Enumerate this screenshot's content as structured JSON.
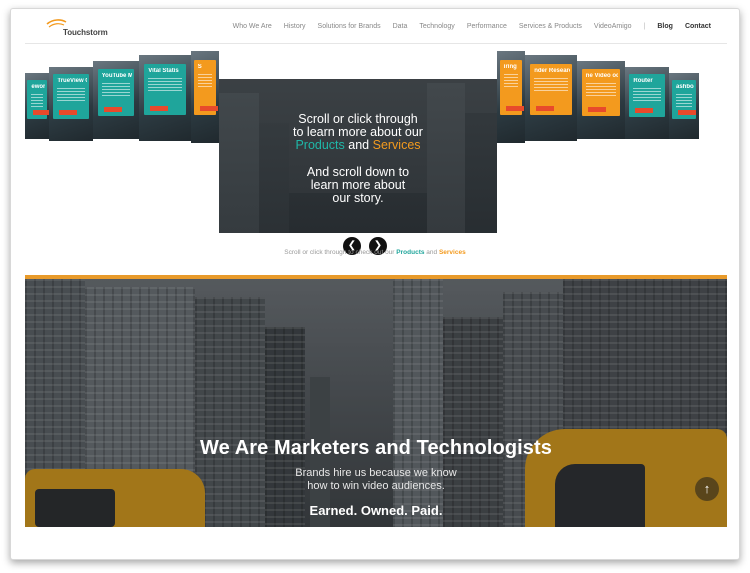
{
  "header": {
    "logo_text": "Touchstorm",
    "nav": [
      {
        "label": "Who We Are",
        "bold": false
      },
      {
        "label": "History",
        "bold": false
      },
      {
        "label": "Solutions for Brands",
        "bold": false
      },
      {
        "label": "Data",
        "bold": false
      },
      {
        "label": "Technology",
        "bold": false
      },
      {
        "label": "Performance",
        "bold": false
      },
      {
        "label": "Services & Products",
        "bold": false
      },
      {
        "label": "VideoAmigo",
        "bold": false
      }
    ],
    "separator": "|",
    "nav_right": [
      {
        "label": "Blog",
        "bold": true
      },
      {
        "label": "Contact",
        "bold": true
      }
    ]
  },
  "carousel": {
    "left_cards": [
      {
        "title": "eword Op",
        "color": "#1fa59b"
      },
      {
        "title": "TrueView Ca",
        "color": "#1fa59b"
      },
      {
        "title": "YouTube Mus",
        "color": "#1fa59b"
      },
      {
        "title": "Vital Statis",
        "color": "#1fa59b"
      },
      {
        "title": "S",
        "color": "#f39a1e"
      }
    ],
    "right_cards": [
      {
        "title": "iring",
        "color": "#f39a1e"
      },
      {
        "title": "nder Research",
        "color": "#f39a1e"
      },
      {
        "title": "ne Video oduction",
        "color": "#f39a1e"
      },
      {
        "title": "Router",
        "color": "#1fa59b"
      },
      {
        "title": "ashboard",
        "color": "#1fa59b"
      }
    ],
    "main_slide": {
      "line1": "Scroll or click through",
      "line2": "to learn more about our",
      "products": "Products",
      "and": "and",
      "services": "Services",
      "line4": "And scroll down to",
      "line5": "learn more about",
      "line6": "our story."
    },
    "prev_icon": "chevron-left-icon",
    "next_icon": "chevron-right-icon",
    "caption_prefix": "Scroll or click through to check out our",
    "caption_products": "Products",
    "caption_and": "and",
    "caption_services": "Services"
  },
  "hero": {
    "title": "We Are Marketers and Technologists",
    "subtitle_line1": "Brands hire us because we know",
    "subtitle_line2": "how to win video audiences.",
    "tagline": "Earned. Owned. Paid.",
    "scroll_top_icon": "arrow-up-icon"
  },
  "colors": {
    "teal": "#1fa59b",
    "orange": "#f39a1e",
    "hero_bar": "#e89a2a"
  }
}
